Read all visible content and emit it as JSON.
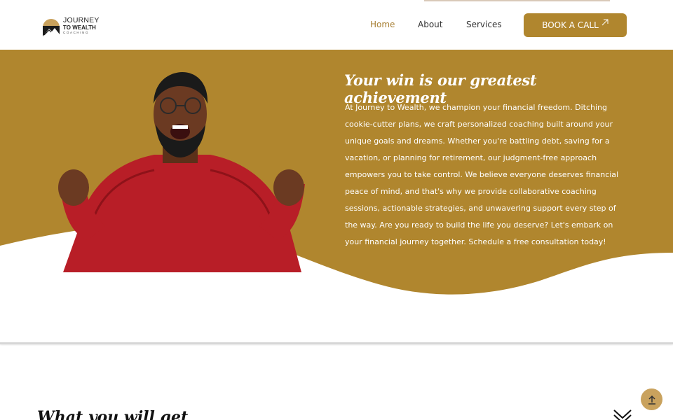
{
  "header": {
    "logo": {
      "line1": "JOURNEY",
      "line2": "TO WEALTH",
      "line3": "COACHING"
    },
    "nav": {
      "home": "Home",
      "about": "About",
      "services": "Services"
    },
    "cta_label": "BOOK A CALL",
    "cta_icon": "arrow-up-right-icon"
  },
  "hero": {
    "title": "Your win is our greatest achievement",
    "body": "At Journey to Wealth, we champion your financial freedom. Ditching cookie-cutter plans, we craft personalized coaching built around your unique goals and dreams. Whether you're battling debt, saving for a vacation, or planning for retirement, our judgment-free approach empowers you to take control. We believe everyone deserves financial peace of mind, and that's why we provide collaborative coaching sessions, actionable strategies, and unwavering support every step of the way. Are you ready to build the life you deserve? Let's embark on your financial journey together. Schedule a free consultation today!",
    "image": "excited-man-in-red-sweater"
  },
  "next_section": {
    "title": "What you will get",
    "toggle_icon": "chevron-down-icon"
  },
  "scroll_top_icon": "arrow-up-icon",
  "colors": {
    "brand_gold": "#b0862e",
    "nav_active": "#a88035",
    "scroll_button": "#c9a25d"
  }
}
